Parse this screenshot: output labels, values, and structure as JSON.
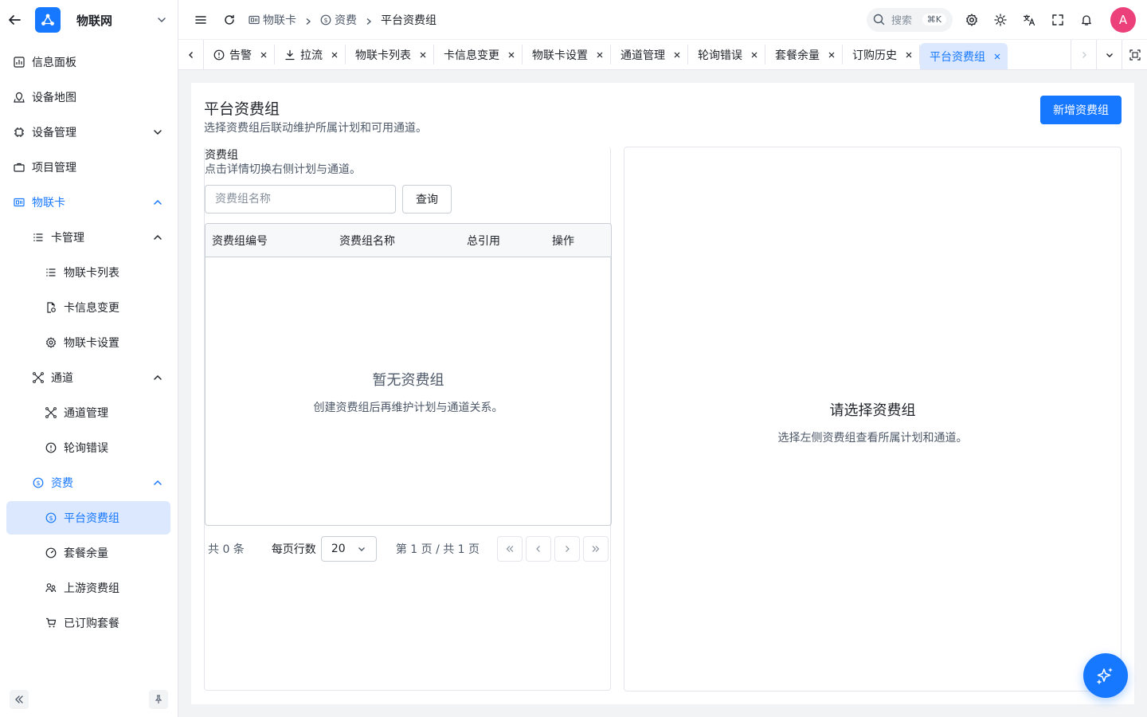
{
  "app": {
    "name": "物联网"
  },
  "sidebar": {
    "items": [
      {
        "label": "信息面板"
      },
      {
        "label": "设备地图"
      },
      {
        "label": "设备管理"
      },
      {
        "label": "项目管理"
      },
      {
        "label": "物联卡"
      },
      {
        "label": "卡管理"
      },
      {
        "label": "物联卡列表"
      },
      {
        "label": "卡信息变更"
      },
      {
        "label": "物联卡设置"
      },
      {
        "label": "通道"
      },
      {
        "label": "通道管理"
      },
      {
        "label": "轮询错误"
      },
      {
        "label": "资费"
      },
      {
        "label": "平台资费组"
      },
      {
        "label": "套餐余量"
      },
      {
        "label": "上游资费组"
      },
      {
        "label": "已订购套餐"
      }
    ]
  },
  "header": {
    "breadcrumbs": [
      "物联卡",
      "资费",
      "平台资费组"
    ],
    "search_label": "搜索",
    "search_kbd": "⌘K",
    "avatar": "A"
  },
  "tabs": [
    "告警",
    "拉流",
    "物联卡列表",
    "卡信息变更",
    "物联卡设置",
    "通道管理",
    "轮询错误",
    "套餐余量",
    "订购历史",
    "平台资费组"
  ],
  "page": {
    "title": "平台资费组",
    "desc": "选择资费组后联动维护所属计划和可用通道。",
    "add_button": "新增资费组"
  },
  "left": {
    "title": "资费组",
    "desc": "点击详情切换右侧计划与通道。",
    "search_placeholder": "资费组名称",
    "query_button": "查询",
    "columns": [
      "资费组编号",
      "资费组名称",
      "总引用",
      "操作"
    ],
    "empty_title": "暂无资费组",
    "empty_desc": "创建资费组后再维护计划与通道关系。"
  },
  "pager": {
    "total": "共 0 条",
    "page_size_label": "每页行数",
    "page_size": "20",
    "page_info": "第 1 页 / 共 1 页"
  },
  "right": {
    "empty_title": "请选择资费组",
    "empty_desc": "选择左侧资费组查看所属计划和通道。"
  },
  "colors": {
    "accent": "#1677ff",
    "avatar": "#ec407a",
    "selected_bg": "#dbe8fd"
  }
}
